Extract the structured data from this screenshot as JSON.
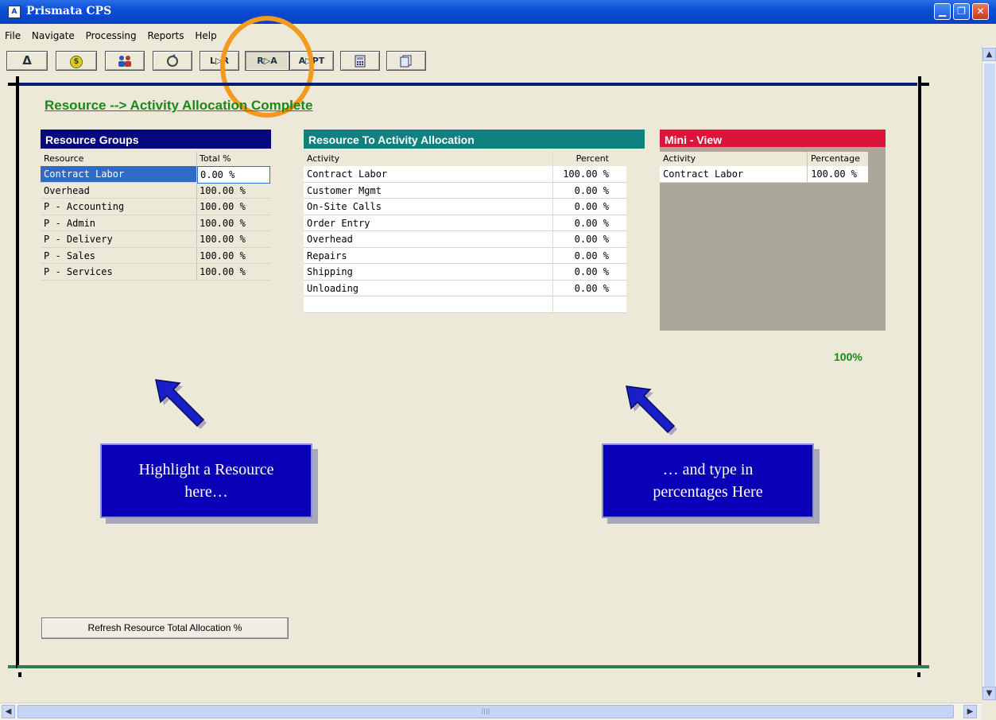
{
  "window": {
    "title": "Prismata CPS",
    "icon_text": "A"
  },
  "menu": [
    "File",
    "Navigate",
    "Processing",
    "Reports",
    "Help"
  ],
  "toolbar": [
    "Δ",
    "$",
    "",
    "",
    "L▷R",
    "R▷A",
    "A▷PT",
    "",
    ""
  ],
  "section_title": "Resource --> Activity Allocation Complete",
  "resource_groups": {
    "title": "Resource Groups",
    "headers": [
      "Resource",
      "Total %"
    ],
    "rows": [
      [
        "Contract Labor",
        "0.00 %"
      ],
      [
        "Overhead",
        "100.00 %"
      ],
      [
        "P - Accounting",
        "100.00 %"
      ],
      [
        "P - Admin",
        "100.00 %"
      ],
      [
        "P - Delivery",
        "100.00 %"
      ],
      [
        "P - Sales",
        "100.00 %"
      ],
      [
        "P - Services",
        "100.00 %"
      ]
    ]
  },
  "allocation": {
    "title": "Resource To Activity Allocation",
    "headers": [
      "Activity",
      "Percent"
    ],
    "rows": [
      [
        "Contract Labor",
        "100.00 %"
      ],
      [
        "Customer Mgmt",
        "0.00 %"
      ],
      [
        "On-Site Calls",
        "0.00 %"
      ],
      [
        "Order Entry",
        "0.00 %"
      ],
      [
        "Overhead",
        "0.00 %"
      ],
      [
        "Repairs",
        "0.00 %"
      ],
      [
        "Shipping",
        "0.00 %"
      ],
      [
        "Unloading",
        "0.00 %"
      ],
      [
        "",
        ""
      ]
    ]
  },
  "mini_view": {
    "title": "Mini - View",
    "headers": [
      "Activity",
      "Percentage"
    ],
    "rows": [
      [
        "Contract Labor",
        "100.00 %"
      ]
    ],
    "total": "100%"
  },
  "callouts": {
    "left": "Highlight a Resource here…",
    "right": "… and type in percentages Here"
  },
  "refresh_button": "Refresh Resource Total Allocation %",
  "scroll": {
    "grip": "||||"
  },
  "colors": {
    "resource_groups_header": "#08087e",
    "allocation_header": "#108080",
    "mini_view_header": "#dc143c",
    "title_green": "#188a18",
    "callout_blue": "#0a00b8",
    "highlight_ring": "#f39a1e"
  }
}
